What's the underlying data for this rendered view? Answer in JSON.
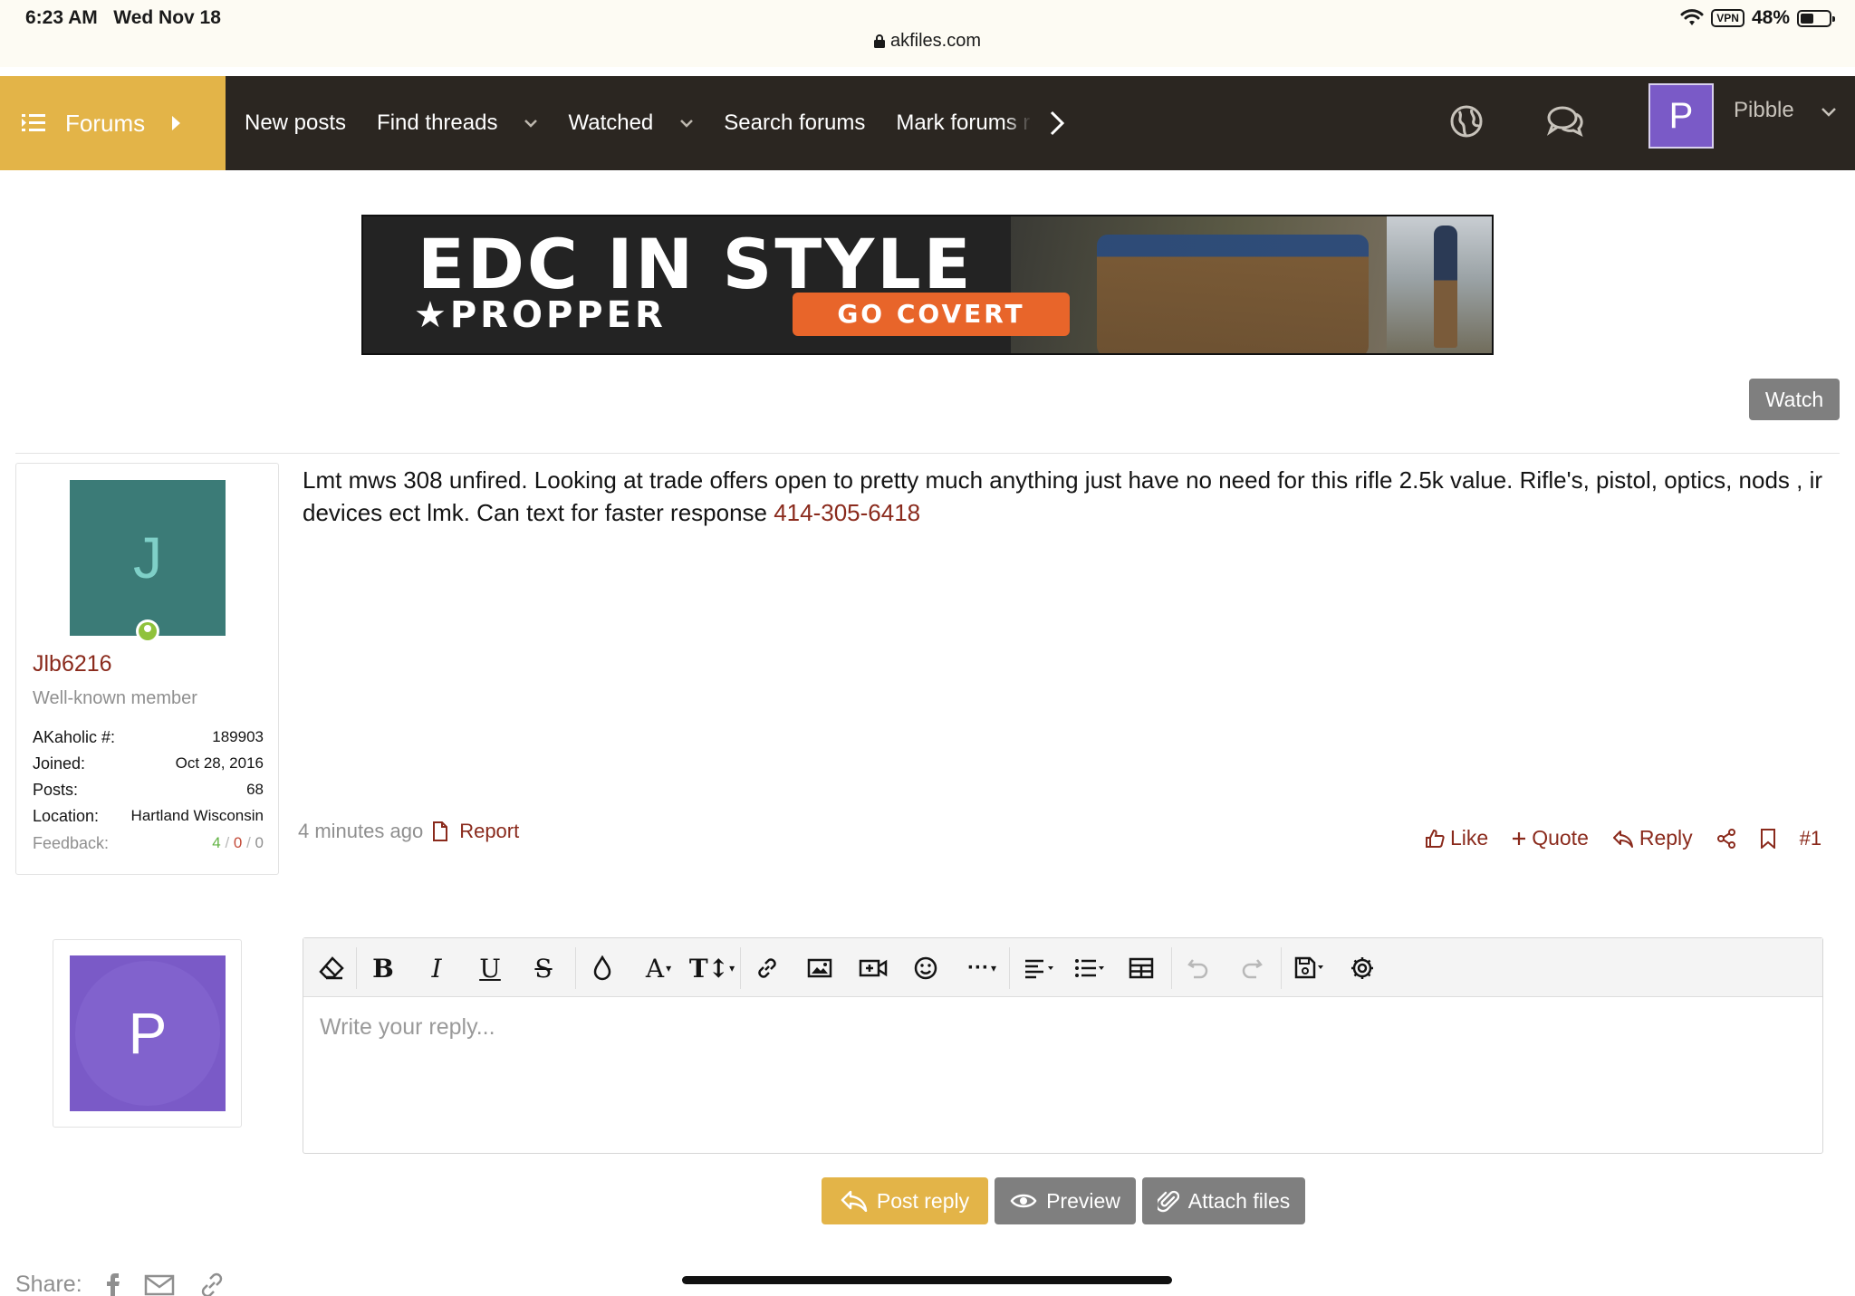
{
  "status_bar": {
    "time": "6:23 AM",
    "date": "Wed Nov 18",
    "url": "akfiles.com",
    "vpn": "VPN",
    "battery": "48%",
    "battery_level": 0.48
  },
  "nav": {
    "forums_label": "Forums",
    "items": [
      "New posts",
      "Find threads",
      "Watched",
      "Search forums",
      "Mark forums read"
    ],
    "user_initial": "P",
    "username": "Pibble"
  },
  "banner": {
    "headline": "EDC IN STYLE",
    "brand": "★PROPPER",
    "cta": "GO COVERT"
  },
  "watch_label": "Watch",
  "author": {
    "initial": "J",
    "name": "Jlb6216",
    "title": "Well-known member",
    "stats": [
      {
        "label": "AKaholic #:",
        "value": "189903"
      },
      {
        "label": "Joined:",
        "value": "Oct 28, 2016"
      },
      {
        "label": "Posts:",
        "value": "68"
      },
      {
        "label": "Location:",
        "value": "Hartland Wisconsin"
      }
    ],
    "feedback_label": "Feedback:",
    "feedback_positive": "4",
    "feedback_neutral": "0",
    "feedback_negative": "0"
  },
  "post": {
    "body": "Lmt mws 308 unfired. Looking at trade offers open to pretty much anything just have no need for this rifle 2.5k value. Rifle's, pistol, optics, nods , ir devices ect lmk. Can text for faster response ",
    "phone": "414-305-6418",
    "time": "4 minutes ago",
    "report": "Report",
    "like": "Like",
    "quote": "Quote",
    "reply": "Reply",
    "number": "#1"
  },
  "reply_form": {
    "user_initial": "P",
    "placeholder": "Write your reply...",
    "post_reply": "Post reply",
    "preview": "Preview",
    "attach": "Attach files"
  },
  "share_label": "Share:"
}
